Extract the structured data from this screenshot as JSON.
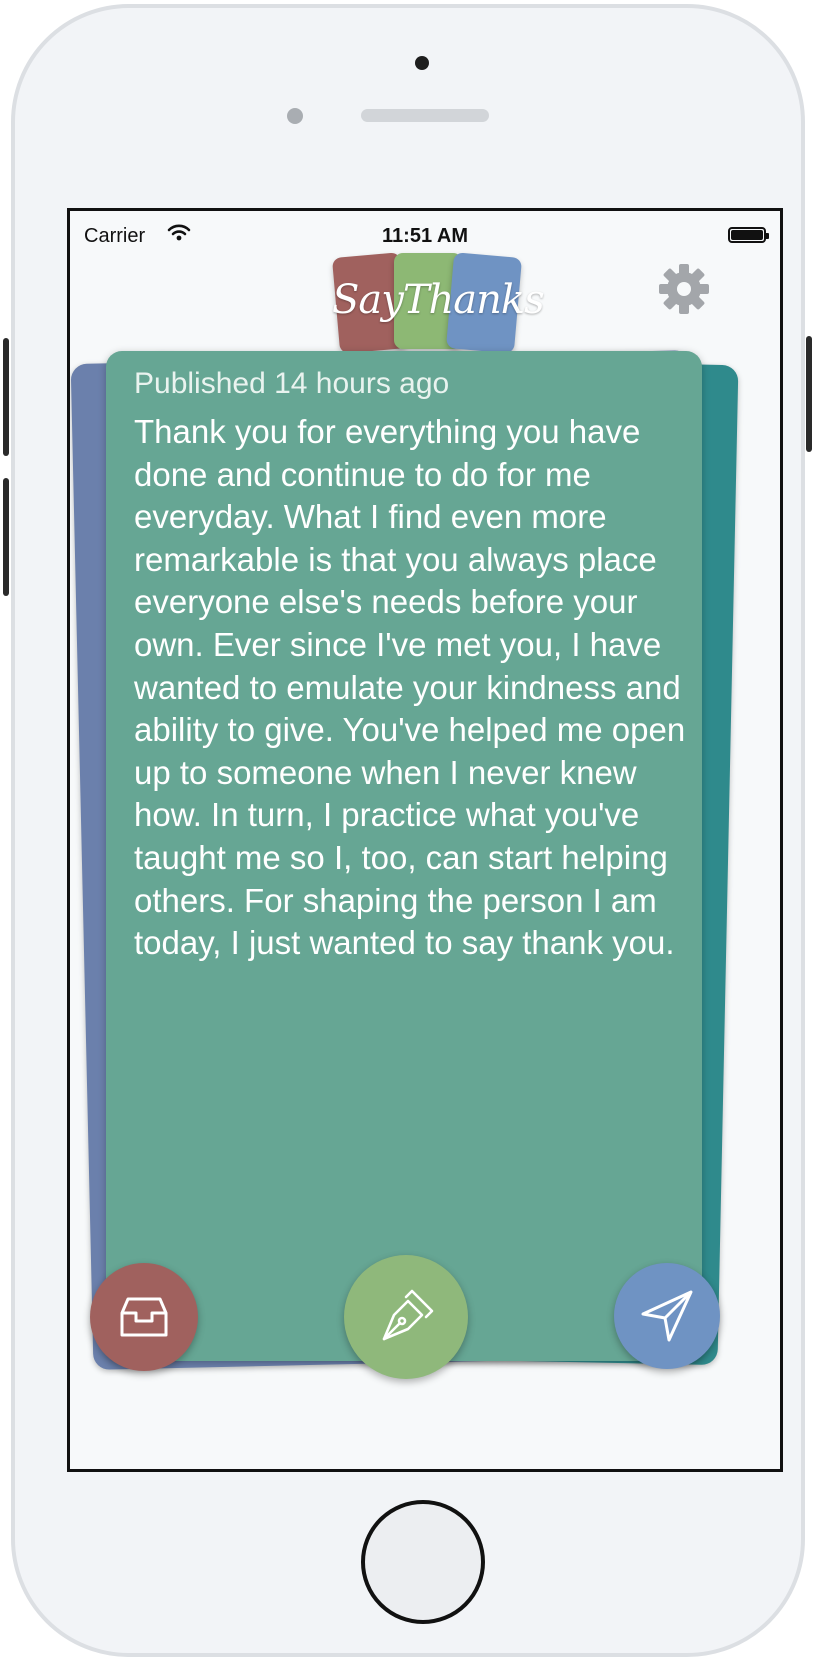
{
  "status_bar": {
    "carrier": "Carrier",
    "time": "11:51 AM"
  },
  "header": {
    "logo_text": "SayThanks",
    "settings_icon": "gear-icon"
  },
  "note": {
    "published": "Published 14 hours ago",
    "message": "Thank you for everything you have done and continue to do for me everyday. What I find even more remarkable is that you always place everyone else's needs before your own. Ever since I've met you, I have wanted to emulate your kindness and ability to give. You've helped me open up to someone when I never knew how. In turn, I practice what you've taught me so I, too, can start helping others. For shaping the person I am today, I just wanted to say thank you."
  },
  "actions": {
    "inbox_icon": "inbox-icon",
    "compose_icon": "fountain-pen-icon",
    "send_icon": "paper-plane-icon"
  },
  "colors": {
    "card_green": "#66a694",
    "card_blue": "#6b80ac",
    "card_teal": "#2f8a8c",
    "red": "#a0615e",
    "green": "#8fb87b",
    "blue": "#6f93c3"
  }
}
